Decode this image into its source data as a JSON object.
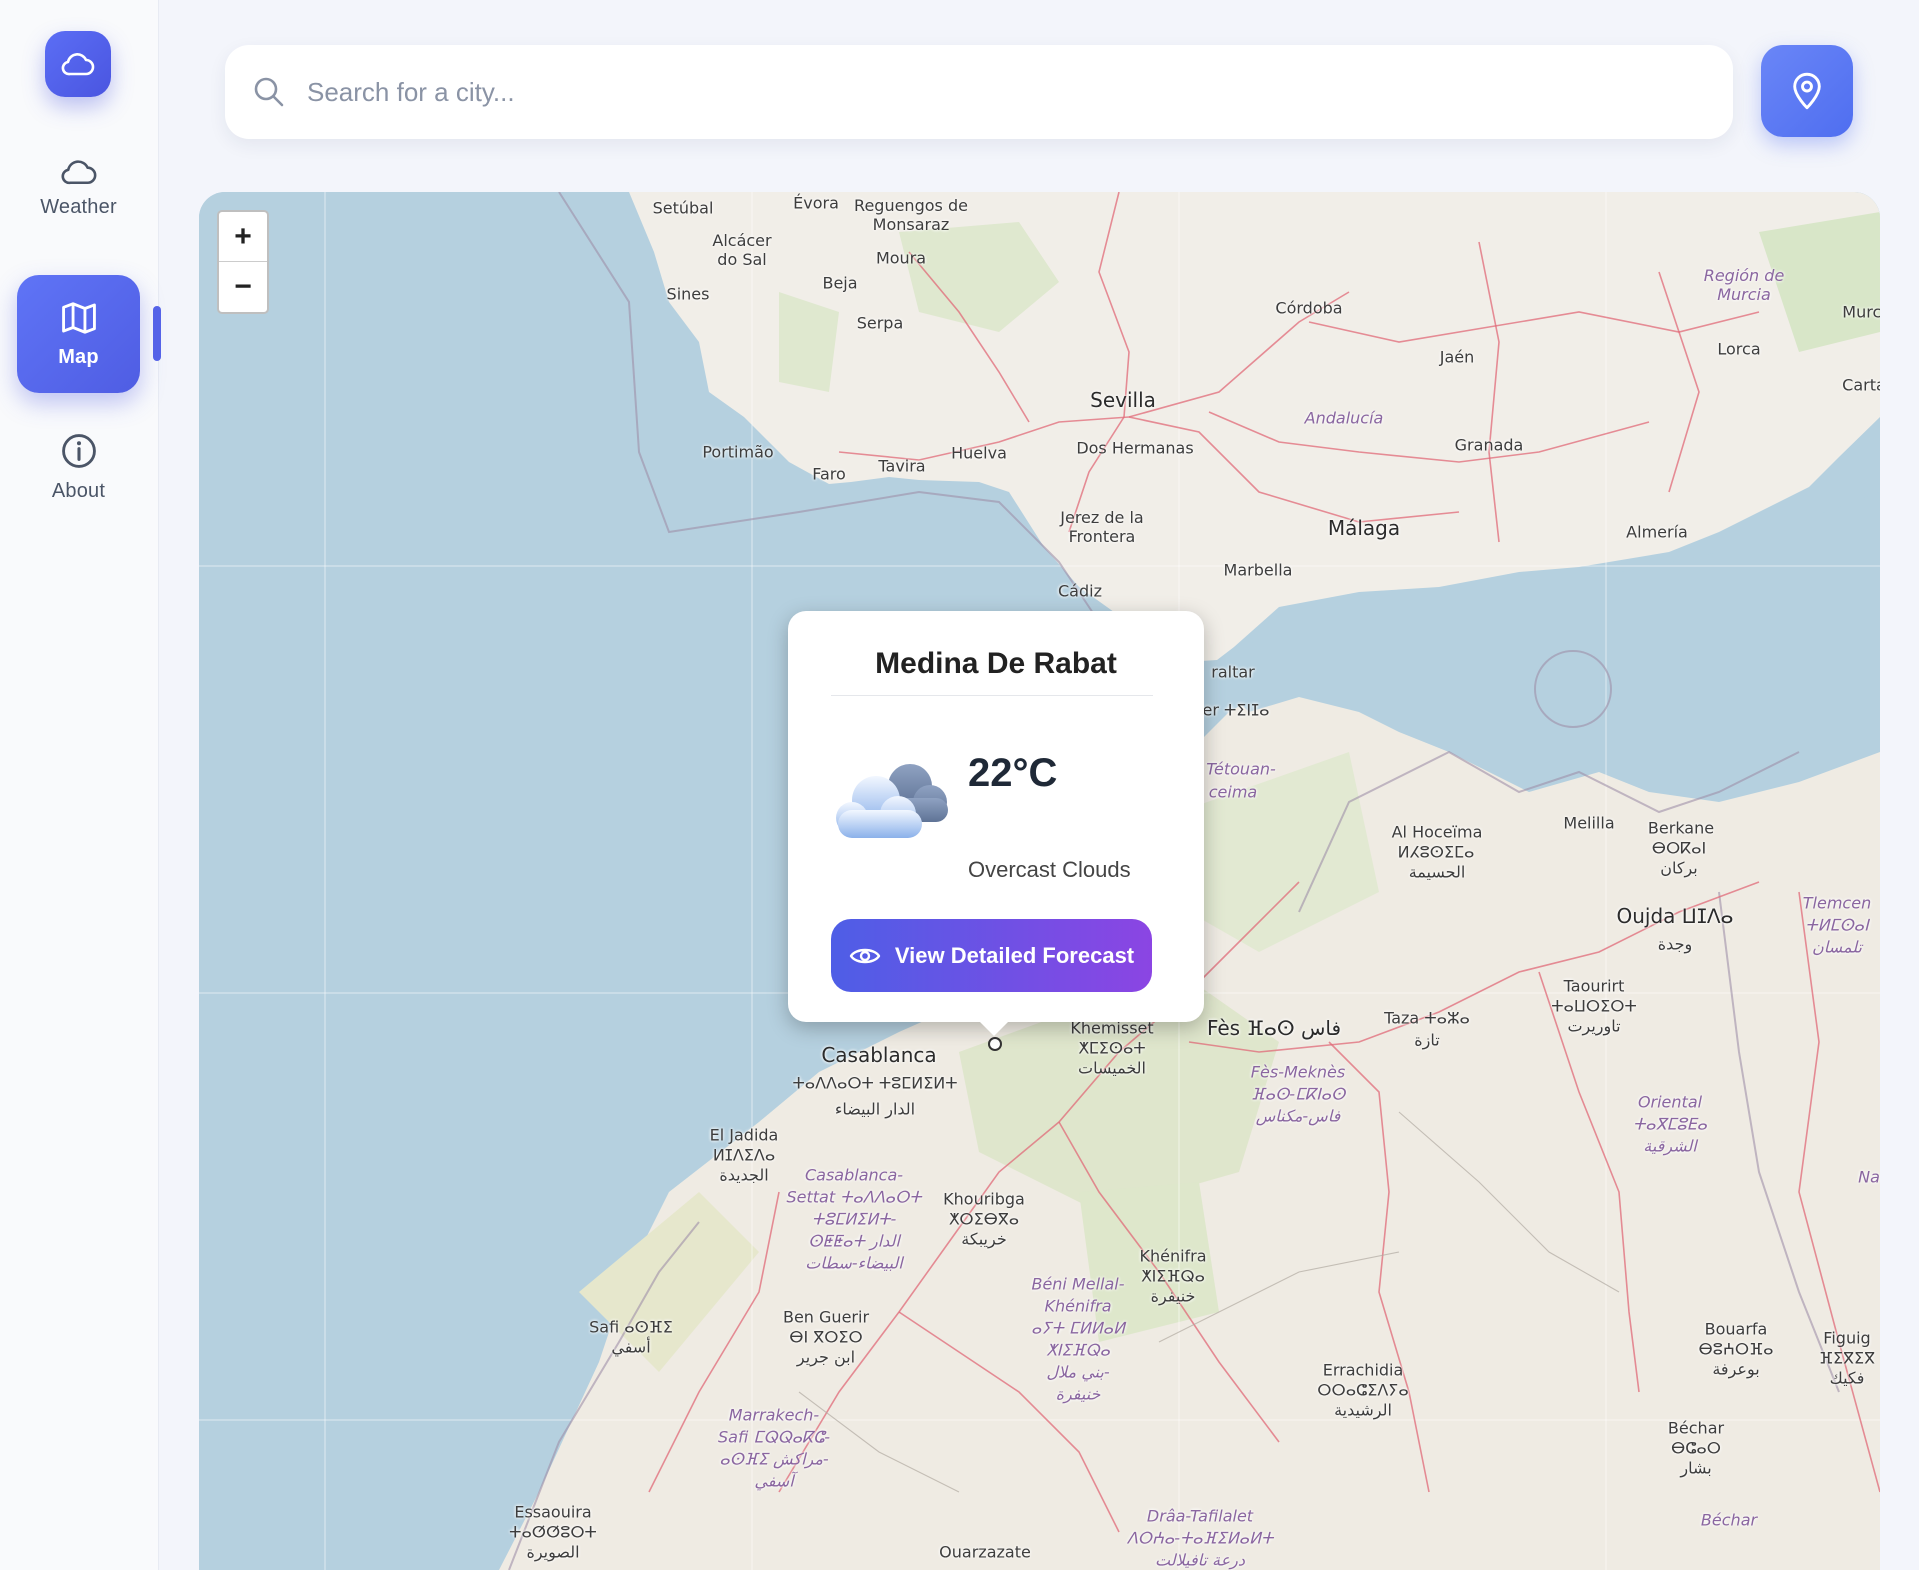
{
  "app": {
    "logo_icon": "cloud-icon",
    "accent": "#5563e8"
  },
  "sidebar": {
    "items": [
      {
        "label": "Weather",
        "icon": "cloud-icon",
        "active": false
      },
      {
        "label": "Map",
        "icon": "map-icon",
        "active": true
      },
      {
        "label": "About",
        "icon": "info-icon",
        "active": false
      }
    ]
  },
  "search": {
    "placeholder": "Search for a city...",
    "value": "",
    "icon": "search-icon"
  },
  "locate_button": {
    "icon": "location-pin-icon"
  },
  "map": {
    "zoom_in": "+",
    "zoom_out": "−",
    "labels": [
      "Setúbal",
      "Évora",
      "Reguengos de Monsaraz",
      "Alcácer do Sal",
      "Moura",
      "Beja",
      "Sines",
      "Serpa",
      "Córdoba",
      "Región de Murcia",
      "Murci",
      "Jaén",
      "Lorca",
      "Sevilla",
      "Andalucía",
      "Carta",
      "Portimão",
      "Faro",
      "Tavira",
      "Huelva",
      "Dos Hermanas",
      "Granada",
      "Jerez de la Frontera",
      "Málaga",
      "Almería",
      "Marbella",
      "Cádiz",
      "raltar",
      "er ⵜⵉⵏⵊⴰ",
      "Tétouan-",
      "ceima",
      "Al Hoceïma",
      "ⵍⵃⵓⵙⵉⵎⴰ",
      "الحسيمة",
      "Melilla",
      "Berkane",
      "ⴱⵔⴽⴰⵏ",
      "بركان",
      "Oujda ⵡⵊⴷⴰ",
      "وجدة",
      "Tlemcen",
      "ⵜⵍⵎⵙⴰⵏ",
      "تلمسان",
      "Taourirt",
      "ⵜⴰⵡⵔⵉⵔⵜ",
      "تاوريرت",
      "Taza ⵜⴰⵣⴰ",
      "تازة",
      "Fès ⴼⴰⵙ فاس",
      "Fès-Meknès",
      "ⴼⴰⵙ-ⵎⴽⵏⴰⵙ",
      "فاس-مكناس",
      "Oriental",
      "ⵜⴰⴳⵎⵓⴹⴰ",
      "الشرقية",
      "Khemisset",
      "ⵅⵎⵉⵙⴰⵜ",
      "الخميسات",
      "Casablanca",
      "ⵜⴰⴷⴷⴰⵔⵜ ⵜⵓⵎⵍⵉⵍⵜ",
      "الدار البيضاء",
      "El Jadida",
      "ⵍⵊⴷⵉⴷⴰ",
      "الجديدة",
      "Casablanca-",
      "Settat ⵜⴰⴷⴷⴰⵔⵜ",
      "ⵜⵓⵎⵍⵉⵍⵜ-",
      "ⵙⵟⵟⴰⵜ الدار",
      "البيضاء-سطات",
      "Khouribga",
      "ⵅⵔⵉⴱⴳⴰ",
      "خريبكة",
      "Khénifra",
      "ⵅⵏⵉⴼⵕⴰ",
      "خنيفرة",
      "Béni Mellal-",
      "Khénifra",
      "ⴰⵢⵜ ⵎⵍⵍⴰⵍ",
      "ⵅⵏⵉⴼⵕⴰ",
      "بني ملال-",
      "خنيفرة",
      "Safi ⴰⵙⴼⵉ",
      "أسفي",
      "Ben Guerir",
      "ⴱⵏ ⴳⵔⵉⵔ",
      "ابن جرير",
      "Marrakech-",
      "Safi ⵎⵕⵕⴰⴽⵛ-",
      "ⴰⵙⴼⵉ مراكش-",
      "آسفي",
      "Errachidia",
      "ⵔⵔⴰⵛⵉⴷⵢⴰ",
      "الرشيدية",
      "Bouarfa",
      "ⴱⵓⵄⵔⴼⴰ",
      "بوعرفة",
      "Figuig",
      "ⴼⵉⴳⵉⴳ",
      "فكيك",
      "Béchar",
      "ⴱⵛⴰⵔ",
      "بشار",
      "Béchar",
      "Essaouira",
      "ⵜⴰⵚⵚⵓⵔⵜ",
      "الصويرة",
      "Ouarzazate",
      "Drâa-Tafilalet",
      "ⴷⵔⵄⴰ-ⵜⴰⴼⵉⵍⴰⵍⵜ",
      "درعة تافيلالت",
      "Na"
    ]
  },
  "popup": {
    "city": "Medina De Rabat",
    "temperature": "22°C",
    "description": "Overcast Clouds",
    "icon": "overcast-clouds-icon",
    "button_label": "View Detailed Forecast",
    "button_icon": "eye-icon"
  }
}
